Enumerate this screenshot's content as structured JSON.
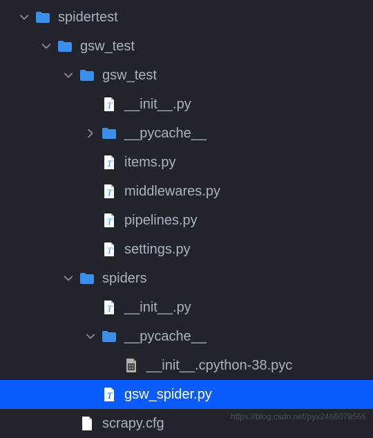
{
  "tree": [
    {
      "id": "spidertest",
      "label": "spidertest",
      "icon": "folder",
      "depth": 0,
      "chevron": "down"
    },
    {
      "id": "gsw_test_outer",
      "label": "gsw_test",
      "icon": "folder",
      "depth": 1,
      "chevron": "down"
    },
    {
      "id": "gsw_test_inner",
      "label": "gsw_test",
      "icon": "folder",
      "depth": 2,
      "chevron": "down"
    },
    {
      "id": "init1",
      "label": "__init__.py",
      "icon": "pyfile",
      "depth": 3,
      "chevron": "none"
    },
    {
      "id": "pycache1",
      "label": "__pycache__",
      "icon": "folder",
      "depth": 3,
      "chevron": "right"
    },
    {
      "id": "items",
      "label": "items.py",
      "icon": "pyfile",
      "depth": 3,
      "chevron": "none"
    },
    {
      "id": "middlewares",
      "label": "middlewares.py",
      "icon": "pyfile",
      "depth": 3,
      "chevron": "none"
    },
    {
      "id": "pipelines",
      "label": "pipelines.py",
      "icon": "pyfile",
      "depth": 3,
      "chevron": "none"
    },
    {
      "id": "settings",
      "label": "settings.py",
      "icon": "pyfile",
      "depth": 3,
      "chevron": "none"
    },
    {
      "id": "spiders",
      "label": "spiders",
      "icon": "folder",
      "depth": 2,
      "chevron": "down"
    },
    {
      "id": "init2",
      "label": "__init__.py",
      "icon": "pyfile",
      "depth": 3,
      "chevron": "none"
    },
    {
      "id": "pycache2",
      "label": "__pycache__",
      "icon": "folder",
      "depth": 3,
      "chevron": "down"
    },
    {
      "id": "initcpython",
      "label": "__init__.cpython-38.pyc",
      "icon": "binfile",
      "depth": 4,
      "chevron": "none"
    },
    {
      "id": "gsw_spider",
      "label": "gsw_spider.py",
      "icon": "pyfile-sel",
      "depth": 3,
      "chevron": "none",
      "selected": true
    },
    {
      "id": "scrapycfg",
      "label": "scrapy.cfg",
      "icon": "plainfile",
      "depth": 2,
      "chevron": "none"
    }
  ],
  "indent_base": 24,
  "indent_step": 32,
  "watermark": "https://blog.csdn.net/pyx2466079565"
}
